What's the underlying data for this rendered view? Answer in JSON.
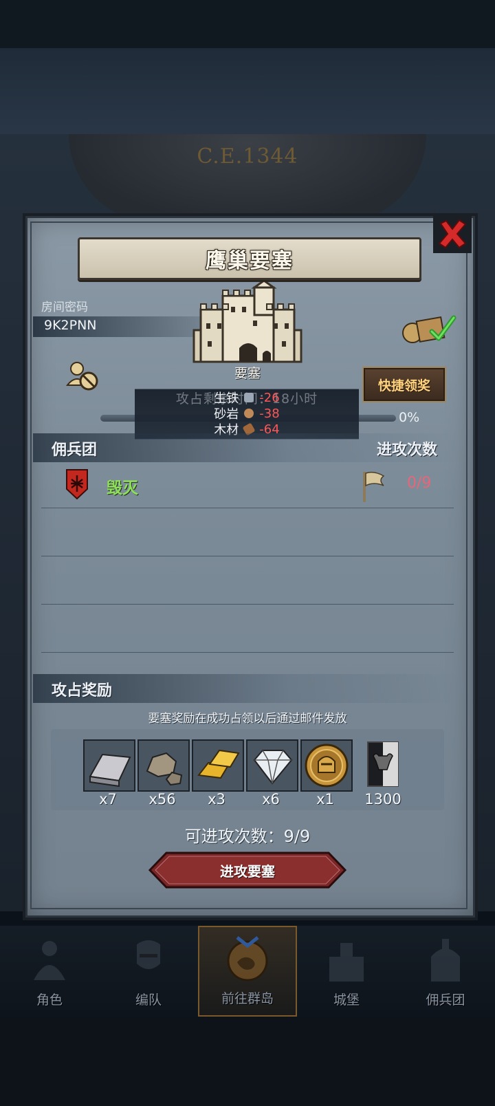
{
  "calendar": {
    "era_text": "C.E.1344"
  },
  "dialog": {
    "title": "鹰巢要塞",
    "room": {
      "label": "房间密码",
      "code": "9K2PNN"
    },
    "fortress_label": "要塞",
    "quick_claim_label": "快捷领奖",
    "overlay_text": "攻占剩余时间：18小时",
    "costs": [
      {
        "name": "生铁",
        "value": "-26",
        "color": "#9ba7b4"
      },
      {
        "name": "砂岩",
        "value": "-38",
        "color": "#c08a58"
      },
      {
        "name": "木材",
        "value": "-64",
        "color": "#a0673a"
      }
    ],
    "progress_percent": "0%",
    "progress_value": 0,
    "sections": {
      "mercenary": "佣兵团",
      "attack_count": "进攻次数",
      "rewards": "攻占奖励"
    },
    "guild_row": {
      "name": "毁灭",
      "count": "0/9"
    },
    "reward_note": "要塞奖励在成功占领以后通过邮件发放",
    "rewards": [
      {
        "icon": "iron-ingot-icon",
        "qty": "x7"
      },
      {
        "icon": "stone-ore-icon",
        "qty": "x56"
      },
      {
        "icon": "gold-bars-icon",
        "qty": "x3"
      },
      {
        "icon": "diamond-icon",
        "qty": "x6"
      },
      {
        "icon": "knight-coin-icon",
        "qty": "x1"
      },
      {
        "icon": "bull-banner-icon",
        "qty": "1300"
      }
    ],
    "attempts_text": "可进攻次数：9/9",
    "attack_button": "进攻要塞"
  },
  "nav": [
    {
      "label": "角色",
      "icon": "character-icon"
    },
    {
      "label": "编队",
      "icon": "formation-icon"
    },
    {
      "label": "前往群岛",
      "icon": "islands-icon",
      "active": true
    },
    {
      "label": "城堡",
      "icon": "castle-icon"
    },
    {
      "label": "佣兵团",
      "icon": "mercenary-icon"
    }
  ]
}
